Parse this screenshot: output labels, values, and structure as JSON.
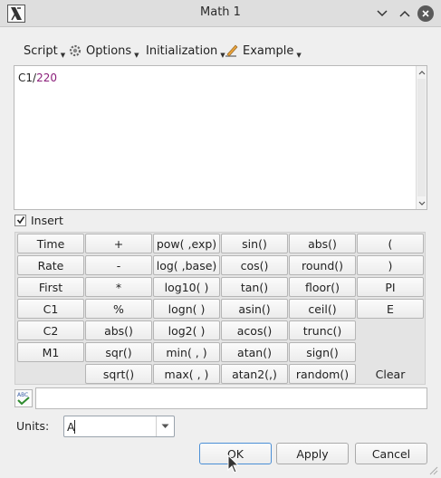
{
  "window": {
    "title": "Math 1"
  },
  "menu": {
    "script": "Script",
    "options": "Options",
    "initialization": "Initialization",
    "example": "Example"
  },
  "editor": {
    "ident": "C1",
    "op": "/",
    "num": "220"
  },
  "insert": {
    "label": "Insert",
    "checked": true
  },
  "keypad": {
    "col1": [
      "Time",
      "Rate",
      "First",
      "C1",
      "C2",
      "M1"
    ],
    "col2": [
      "+",
      "-",
      "*",
      "%",
      "abs()",
      "sqr()",
      "sqrt()"
    ],
    "col3": [
      "pow( ,exp)",
      "log( ,base)",
      "log10( )",
      "logn( )",
      "log2( )",
      "min( , )",
      "max( , )"
    ],
    "col4": [
      "sin()",
      "cos()",
      "tan()",
      "asin()",
      "acos()",
      "atan()",
      "atan2(,)"
    ],
    "col5": [
      "abs()",
      "round()",
      "floor()",
      "ceil()",
      "trunc()",
      "sign()",
      "random()"
    ],
    "col6": [
      "(",
      ")",
      "PI",
      "E"
    ],
    "clear": "Clear"
  },
  "formula": {
    "value": ""
  },
  "units": {
    "label": "Units:",
    "value": "A"
  },
  "buttons": {
    "ok": "OK",
    "apply": "Apply",
    "cancel": "Cancel"
  },
  "colors": {
    "number": "#8b1f7a",
    "ok_border": "#4b8fd6"
  }
}
